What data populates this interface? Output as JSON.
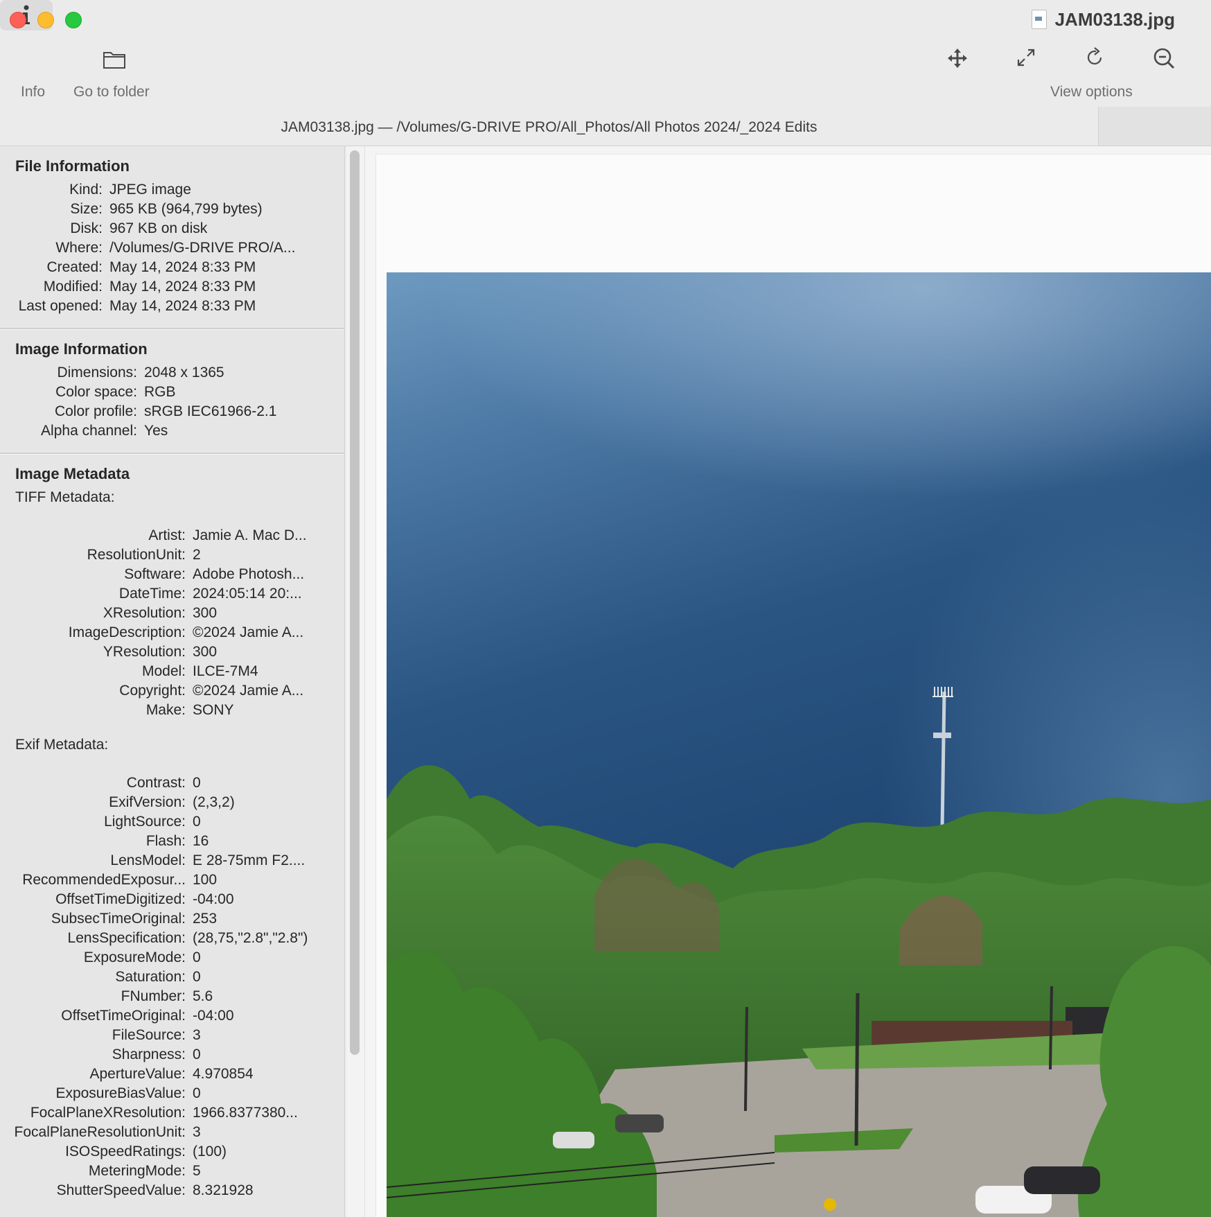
{
  "window": {
    "title": "JAM03138.jpg",
    "path_bar": "JAM03138.jpg  —  /Volumes/G-DRIVE PRO/All_Photos/All Photos 2024/_2024 Edits"
  },
  "toolbar": {
    "info_label": "Info",
    "go_to_folder_label": "Go to folder",
    "view_options_label": "View options",
    "icons": [
      "info-icon",
      "folder-icon",
      "move-icon",
      "fullscreen-icon",
      "rotate-icon",
      "zoom-out-icon"
    ]
  },
  "sidebar": {
    "file_info": {
      "title": "File Information",
      "rows": [
        {
          "k": "Kind:",
          "v": "JPEG image"
        },
        {
          "k": "Size:",
          "v": "965 KB (964,799 bytes)"
        },
        {
          "k": "Disk:",
          "v": "967 KB on disk"
        },
        {
          "k": "Where:",
          "v": "/Volumes/G-DRIVE PRO/A..."
        },
        {
          "k": "Created:",
          "v": "May 14, 2024 8:33 PM"
        },
        {
          "k": "Modified:",
          "v": "May 14, 2024 8:33 PM"
        },
        {
          "k": "Last opened:",
          "v": "May 14, 2024 8:33 PM"
        }
      ]
    },
    "image_info": {
      "title": "Image Information",
      "rows": [
        {
          "k": "Dimensions:",
          "v": "2048 x 1365"
        },
        {
          "k": "Color space:",
          "v": "RGB"
        },
        {
          "k": "Color profile:",
          "v": "sRGB IEC61966-2.1"
        },
        {
          "k": "Alpha channel:",
          "v": "Yes"
        }
      ]
    },
    "metadata": {
      "title": "Image Metadata",
      "tiff_title": "TIFF Metadata:",
      "tiff_rows": [
        {
          "k": "Artist:",
          "v": "Jamie A. Mac D..."
        },
        {
          "k": "ResolutionUnit:",
          "v": "2"
        },
        {
          "k": "Software:",
          "v": "Adobe Photosh..."
        },
        {
          "k": "DateTime:",
          "v": "2024:05:14 20:..."
        },
        {
          "k": "XResolution:",
          "v": "300"
        },
        {
          "k": "ImageDescription:",
          "v": "©2024 Jamie A..."
        },
        {
          "k": "YResolution:",
          "v": "300"
        },
        {
          "k": "Model:",
          "v": "ILCE-7M4"
        },
        {
          "k": "Copyright:",
          "v": "©2024 Jamie A..."
        },
        {
          "k": "Make:",
          "v": "SONY"
        }
      ],
      "exif_title": "Exif Metadata:",
      "exif_rows": [
        {
          "k": "Contrast:",
          "v": "0"
        },
        {
          "k": "ExifVersion:",
          "v": "(2,3,2)"
        },
        {
          "k": "LightSource:",
          "v": "0"
        },
        {
          "k": "Flash:",
          "v": "16"
        },
        {
          "k": "LensModel:",
          "v": "E 28-75mm F2...."
        },
        {
          "k": "RecommendedExposur...",
          "v": "100"
        },
        {
          "k": "OffsetTimeDigitized:",
          "v": "-04:00"
        },
        {
          "k": "SubsecTimeOriginal:",
          "v": "253"
        },
        {
          "k": "LensSpecification:",
          "v": "(28,75,\"2.8\",\"2.8\")"
        },
        {
          "k": "ExposureMode:",
          "v": "0"
        },
        {
          "k": "Saturation:",
          "v": "0"
        },
        {
          "k": "FNumber:",
          "v": "5.6"
        },
        {
          "k": "OffsetTimeOriginal:",
          "v": "-04:00"
        },
        {
          "k": "FileSource:",
          "v": "3"
        },
        {
          "k": "Sharpness:",
          "v": "0"
        },
        {
          "k": "ApertureValue:",
          "v": "4.970854"
        },
        {
          "k": "ExposureBiasValue:",
          "v": "0"
        },
        {
          "k": "FocalPlaneXResolution:",
          "v": "1966.8377380..."
        },
        {
          "k": "FocalPlaneResolutionUnit:",
          "v": "3"
        },
        {
          "k": "ISOSpeedRatings:",
          "v": "(100)"
        },
        {
          "k": "MeteringMode:",
          "v": "5"
        },
        {
          "k": "ShutterSpeedValue:",
          "v": "8.321928"
        }
      ]
    }
  }
}
